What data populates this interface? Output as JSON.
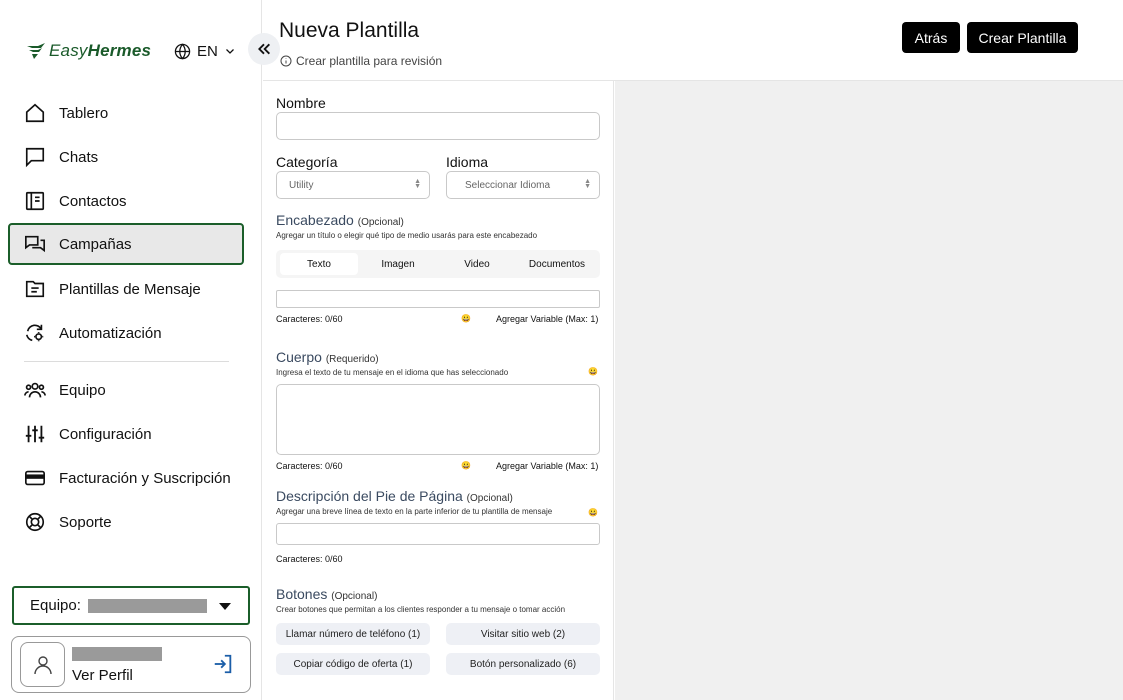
{
  "brand": {
    "prefix": "Easy",
    "bold": "Hermes",
    "color": "#1a5a2a"
  },
  "language": {
    "code": "EN"
  },
  "nav": [
    {
      "label": "Tablero",
      "icon": "home-icon"
    },
    {
      "label": "Chats",
      "icon": "chat-icon"
    },
    {
      "label": "Contactos",
      "icon": "address-book-icon"
    },
    {
      "label": "Campañas",
      "icon": "campaign-icon",
      "active": true
    },
    {
      "label": "Plantillas de Mensaje",
      "icon": "file-template-icon"
    },
    {
      "label": "Automatización",
      "icon": "automation-icon"
    },
    {
      "label": "Equipo",
      "icon": "team-icon"
    },
    {
      "label": "Configuración",
      "icon": "sliders-icon"
    },
    {
      "label": "Facturación y Suscripción",
      "icon": "credit-card-icon"
    },
    {
      "label": "Soporte",
      "icon": "lifebuoy-icon"
    }
  ],
  "team": {
    "label": "Equipo:"
  },
  "profile": {
    "link": "Ver Perfil"
  },
  "header": {
    "title": "Nueva Plantilla",
    "subtitle": "Crear plantilla para revisión",
    "back_label": "Atrás",
    "create_label": "Crear Plantilla"
  },
  "form": {
    "name_label": "Nombre",
    "category_label": "Categoría",
    "category_value": "Utility",
    "language_label": "Idioma",
    "language_placeholder": "Seleccionar Idioma",
    "header_section": {
      "title": "Encabezado",
      "optional": "(Opcional)",
      "hint": "Agregar un título o elegir qué tipo de medio usarás para este encabezado",
      "tabs": [
        "Texto",
        "Imagen",
        "Video",
        "Documentos"
      ],
      "chars": "Caracteres: 0/60",
      "add_variable": "Agregar Variable (Max: 1)"
    },
    "body_section": {
      "title": "Cuerpo",
      "required": "(Requerido)",
      "hint": "Ingresa el texto de tu mensaje en el idioma que has seleccionado",
      "chars": "Caracteres: 0/60",
      "add_variable": "Agregar Variable (Max: 1)"
    },
    "footer_section": {
      "title": "Descripción del Pie de Página",
      "optional": "(Opcional)",
      "hint": "Agregar una breve línea de texto en la parte inferior de tu plantilla de mensaje",
      "chars": "Caracteres: 0/60"
    },
    "buttons_section": {
      "title": "Botones",
      "optional": "(Opcional)",
      "hint": "Crear botones que permitan a los clientes responder a tu mensaje o tomar acción",
      "buttons": [
        "Llamar número de teléfono (1)",
        "Visitar sitio web (2)",
        "Copiar código de oferta (1)",
        "Botón personalizado (6)"
      ]
    },
    "emoji": "😀"
  }
}
